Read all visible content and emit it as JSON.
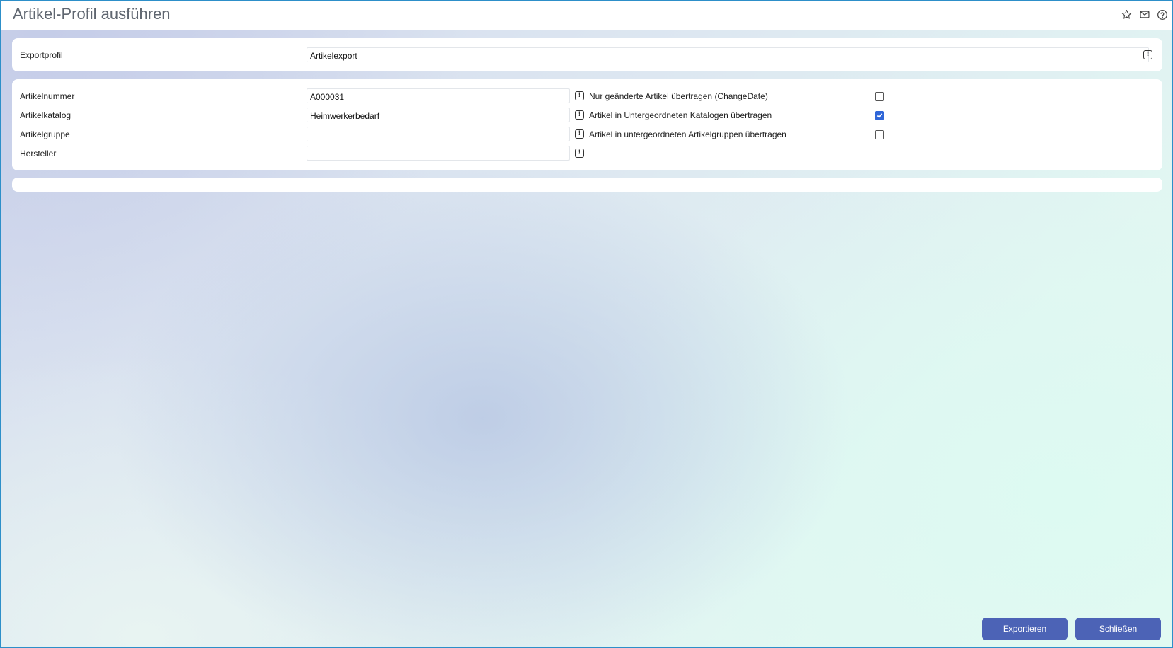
{
  "window": {
    "title": "Artikel-Profil ausführen"
  },
  "title_icons": [
    "star-icon",
    "mail-icon",
    "help-icon"
  ],
  "profile_section": {
    "label": "Exportprofil",
    "value": "Artikelexport"
  },
  "filter_section": {
    "fields": [
      {
        "label": "Artikelnummer",
        "value": "A000031"
      },
      {
        "label": "Artikelkatalog",
        "value": "Heimwerkerbedarf"
      },
      {
        "label": "Artikelgruppe",
        "value": ""
      },
      {
        "label": "Hersteller",
        "value": ""
      }
    ],
    "options": [
      {
        "label": "Nur geänderte Artikel übertragen (ChangeDate)",
        "checked": false
      },
      {
        "label": "Artikel in Untergeordneten Katalogen übertragen",
        "checked": true
      },
      {
        "label": "Artikel in untergeordneten Artikelgruppen übertragen",
        "checked": false
      }
    ]
  },
  "info_glyph": "!",
  "buttons": {
    "export_label": "Exportieren",
    "close_label": "Schließen"
  },
  "colors": {
    "accent": "#4c63b6",
    "checkbox_checked": "#2f66d8",
    "window_border": "#2d8fc9"
  }
}
